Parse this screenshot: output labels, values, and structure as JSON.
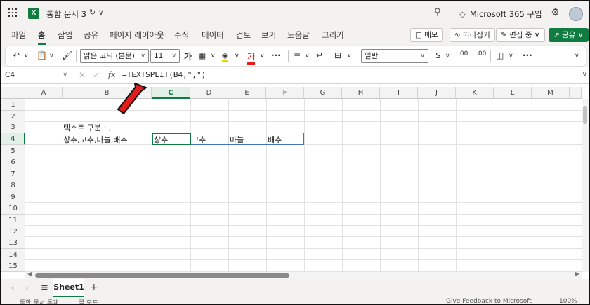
{
  "titlebar": {
    "doc_title": "통합 문서 3",
    "sync_glyph": "↻ ∨",
    "ms365_label": "Microsoft 365 구입",
    "icons": [
      "waffle-icon",
      "excel-logo",
      "search-icon",
      "diamond-icon",
      "gear-icon",
      "avatar"
    ]
  },
  "ribbon": {
    "tabs": [
      "파일",
      "홈",
      "삽입",
      "공유",
      "페이지 레이아웃",
      "수식",
      "데이터",
      "검토",
      "보기",
      "도움말",
      "그리기"
    ],
    "active_tab": "홈",
    "memo_label": "메모",
    "catchup_label": "따라잡기",
    "editing_label": "편집 중",
    "share_label": "공유"
  },
  "toolbar": {
    "font_name": "맑은 고딕 (본문)",
    "font_size": "11",
    "bold_glyph": "가",
    "font_color_glyph": "가",
    "more_glyph": "···",
    "number_format": "일반",
    "currency_glyph": "$",
    "inc_decimal": ".00",
    "dec_decimal": ".00"
  },
  "formula_bar": {
    "name_box": "C4",
    "fx_label": "fx",
    "formula": "=TEXTSPLIT(B4,\",\")"
  },
  "grid": {
    "columns": [
      "A",
      "B",
      "C",
      "D",
      "E",
      "F",
      "G",
      "H",
      "I",
      "J",
      "K",
      "L",
      "M"
    ],
    "rows": [
      "1",
      "2",
      "3",
      "4",
      "5",
      "6",
      "7",
      "8",
      "9",
      "10",
      "11",
      "12",
      "13",
      "14",
      "15"
    ],
    "selected_column": "C",
    "selected_row": "4",
    "cells": {
      "B3": "텍스트 구분 : ,",
      "B4": "상추,고추,마늘,배추",
      "C4": "상추",
      "D4": "고추",
      "E4": "마늘",
      "F4": "배추"
    }
  },
  "sheets": {
    "tabs": [
      "Sheet1"
    ],
    "active": "Sheet1",
    "add_glyph": "+"
  },
  "statusbar": {
    "left": "통합 문서 통계",
    "mode": "끌 모드",
    "feedback": "Give Feedback to Microsoft",
    "zoom": "100%"
  },
  "colors": {
    "accent": "#107c41",
    "arrow": "#e21d1d",
    "spill_border": "#4472c4"
  }
}
